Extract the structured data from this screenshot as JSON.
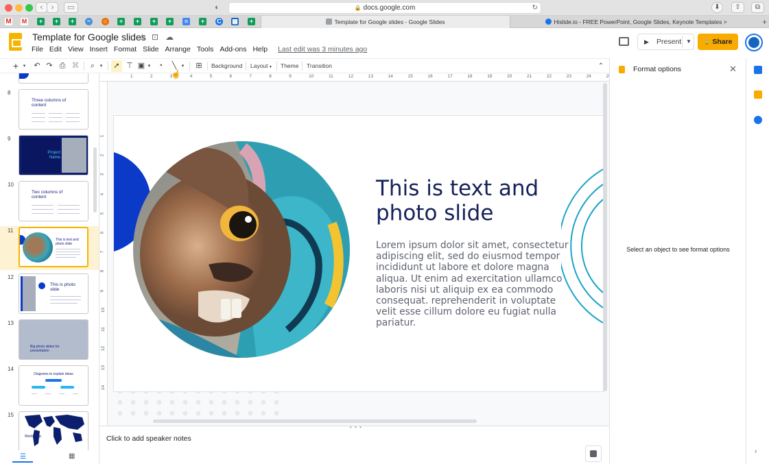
{
  "browser": {
    "url": "docs.google.com",
    "tabs": [
      {
        "label": "Template for Google slides - Google Slides",
        "active": true
      },
      {
        "label": "Hislide.io - FREE PowerPoint, Google Slides, Keynote Templates >",
        "active": false
      }
    ],
    "new_tab": "+"
  },
  "app": {
    "doc_title": "Template for Google slides",
    "menu": [
      "File",
      "Edit",
      "View",
      "Insert",
      "Format",
      "Slide",
      "Arrange",
      "Tools",
      "Add-ons",
      "Help"
    ],
    "last_edit": "Last edit was 3 minutes ago",
    "present_label": "Present",
    "share_label": "Share"
  },
  "toolbar": {
    "background_label": "Background",
    "layout_label": "Layout",
    "theme_label": "Theme",
    "transition_label": "Transition"
  },
  "format_panel": {
    "title": "Format options",
    "message": "Select an object to see format options"
  },
  "filmstrip": {
    "selected": "11",
    "slides": [
      {
        "num": "8",
        "label": "Three columns of content"
      },
      {
        "num": "9",
        "label": "Project Name"
      },
      {
        "num": "10",
        "label": "Two columns of content"
      },
      {
        "num": "11",
        "label": "This is text and photo slide"
      },
      {
        "num": "12",
        "label": "This is photo slide"
      },
      {
        "num": "13",
        "label": "Big photo slides for presentation"
      },
      {
        "num": "14",
        "label": "Diagrams to explain ideas"
      },
      {
        "num": "15",
        "label": "World map"
      }
    ]
  },
  "ruler": {
    "h_ticks": [
      "1",
      "2",
      "3",
      "4",
      "5",
      "6",
      "7",
      "8",
      "9",
      "10",
      "11",
      "12",
      "13",
      "14",
      "15",
      "16",
      "17",
      "18",
      "19",
      "20",
      "21",
      "22",
      "23",
      "24",
      "25"
    ],
    "v_ticks": [
      "1",
      "2",
      "3",
      "4",
      "5",
      "6",
      "7",
      "8",
      "9",
      "10",
      "11",
      "12",
      "13",
      "14"
    ]
  },
  "slide": {
    "title": "This is text and photo slide",
    "body": "Lorem ipsum dolor sit amet, consectetur adipiscing elit, sed do eiusmod tempor incididunt ut labore et dolore magna aliqua. Ut enim ad exercitation ullamco laboris nisi ut aliquip ex ea commodo consequat. reprehenderit in voluptate velit esse cillum dolore eu fugiat nulla pariatur."
  },
  "notes": {
    "placeholder": "Click to add speaker notes"
  },
  "colors": {
    "accent_yellow": "#f4b400",
    "share_yellow": "#f9ab00",
    "slide_navy": "#152158",
    "slide_blue": "#0b3ac9",
    "arc_teal": "#1aa3c8"
  }
}
